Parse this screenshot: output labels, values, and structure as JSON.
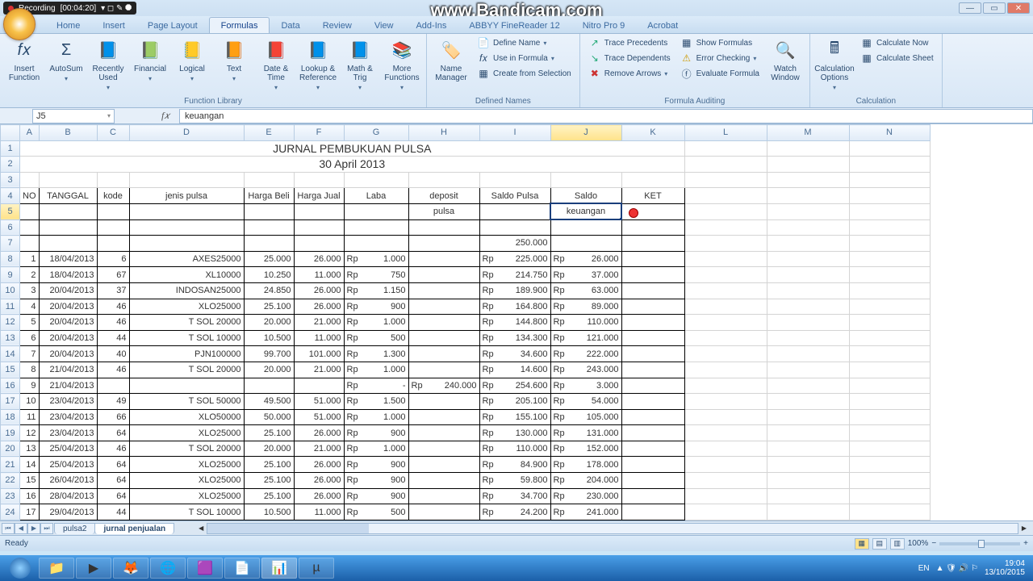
{
  "recorder": {
    "label": "Recording",
    "time": "00:04:20"
  },
  "watermark": "www.Bandicam.com",
  "window": {
    "app": "Microsoft Excel"
  },
  "tabs": [
    "Home",
    "Insert",
    "Page Layout",
    "Formulas",
    "Data",
    "Review",
    "View",
    "Add-Ins",
    "ABBYY FineReader 12",
    "Nitro Pro 9",
    "Acrobat"
  ],
  "active_tab": "Formulas",
  "ribbon": {
    "function_library": {
      "label": "Function Library",
      "items": [
        "Insert Function",
        "AutoSum",
        "Recently Used",
        "Financial",
        "Logical",
        "Text",
        "Date & Time",
        "Lookup & Reference",
        "Math & Trig",
        "More Functions"
      ]
    },
    "defined_names": {
      "label": "Defined Names",
      "big": "Name Manager",
      "items": [
        "Define Name",
        "Use in Formula",
        "Create from Selection"
      ]
    },
    "formula_auditing": {
      "label": "Formula Auditing",
      "left": [
        "Trace Precedents",
        "Trace Dependents",
        "Remove Arrows"
      ],
      "right": [
        "Show Formulas",
        "Error Checking",
        "Evaluate Formula"
      ],
      "watch": "Watch Window"
    },
    "calculation": {
      "label": "Calculation",
      "big": "Calculation Options",
      "items": [
        "Calculate Now",
        "Calculate Sheet"
      ]
    }
  },
  "namebox": "J5",
  "formula": "keuangan",
  "columns": [
    "A",
    "B",
    "C",
    "D",
    "E",
    "F",
    "G",
    "H",
    "I",
    "J",
    "K",
    "L",
    "M",
    "N"
  ],
  "title": "JURNAL PEMBUKUAN PULSA",
  "subtitle": "30 April 2013",
  "headers": [
    "NO",
    "TANGGAL",
    "kode",
    "jenis pulsa",
    "Harga Beli",
    "Harga Jual",
    "Laba",
    "deposit",
    "Saldo Pulsa",
    "Saldo",
    "KET"
  ],
  "subheaders": {
    "H": "pulsa",
    "J": "keuangan"
  },
  "initial_saldo": "250.000",
  "rows": [
    {
      "no": 1,
      "tgl": "18/04/2013",
      "kode": 6,
      "jenis": "AXES25000",
      "beli": "25.000",
      "jual": "26.000",
      "laba": "1.000",
      "dep": "",
      "saldoP": "225.000",
      "saldoK": "26.000"
    },
    {
      "no": 2,
      "tgl": "18/04/2013",
      "kode": 67,
      "jenis": "XL10000",
      "beli": "10.250",
      "jual": "11.000",
      "laba": "750",
      "dep": "",
      "saldoP": "214.750",
      "saldoK": "37.000"
    },
    {
      "no": 3,
      "tgl": "20/04/2013",
      "kode": 37,
      "jenis": "INDOSAN25000",
      "beli": "24.850",
      "jual": "26.000",
      "laba": "1.150",
      "dep": "",
      "saldoP": "189.900",
      "saldoK": "63.000"
    },
    {
      "no": 4,
      "tgl": "20/04/2013",
      "kode": 46,
      "jenis": "XLO25000",
      "beli": "25.100",
      "jual": "26.000",
      "laba": "900",
      "dep": "",
      "saldoP": "164.800",
      "saldoK": "89.000"
    },
    {
      "no": 5,
      "tgl": "20/04/2013",
      "kode": 46,
      "jenis": "T SOL 20000",
      "beli": "20.000",
      "jual": "21.000",
      "laba": "1.000",
      "dep": "",
      "saldoP": "144.800",
      "saldoK": "110.000"
    },
    {
      "no": 6,
      "tgl": "20/04/2013",
      "kode": 44,
      "jenis": "T SOL 10000",
      "beli": "10.500",
      "jual": "11.000",
      "laba": "500",
      "dep": "",
      "saldoP": "134.300",
      "saldoK": "121.000"
    },
    {
      "no": 7,
      "tgl": "20/04/2013",
      "kode": 40,
      "jenis": "PJN100000",
      "beli": "99.700",
      "jual": "101.000",
      "laba": "1.300",
      "dep": "",
      "saldoP": "34.600",
      "saldoK": "222.000"
    },
    {
      "no": 8,
      "tgl": "21/04/2013",
      "kode": 46,
      "jenis": "T SOL 20000",
      "beli": "20.000",
      "jual": "21.000",
      "laba": "1.000",
      "dep": "",
      "saldoP": "14.600",
      "saldoK": "243.000"
    },
    {
      "no": 9,
      "tgl": "21/04/2013",
      "kode": "",
      "jenis": "",
      "beli": "",
      "jual": "",
      "laba": "-",
      "dep": "240.000",
      "saldoP": "254.600",
      "saldoK": "3.000"
    },
    {
      "no": 10,
      "tgl": "23/04/2013",
      "kode": 49,
      "jenis": "T SOL 50000",
      "beli": "49.500",
      "jual": "51.000",
      "laba": "1.500",
      "dep": "",
      "saldoP": "205.100",
      "saldoK": "54.000"
    },
    {
      "no": 11,
      "tgl": "23/04/2013",
      "kode": 66,
      "jenis": "XLO50000",
      "beli": "50.000",
      "jual": "51.000",
      "laba": "1.000",
      "dep": "",
      "saldoP": "155.100",
      "saldoK": "105.000"
    },
    {
      "no": 12,
      "tgl": "23/04/2013",
      "kode": 64,
      "jenis": "XLO25000",
      "beli": "25.100",
      "jual": "26.000",
      "laba": "900",
      "dep": "",
      "saldoP": "130.000",
      "saldoK": "131.000"
    },
    {
      "no": 13,
      "tgl": "25/04/2013",
      "kode": 46,
      "jenis": "T SOL 20000",
      "beli": "20.000",
      "jual": "21.000",
      "laba": "1.000",
      "dep": "",
      "saldoP": "110.000",
      "saldoK": "152.000"
    },
    {
      "no": 14,
      "tgl": "25/04/2013",
      "kode": 64,
      "jenis": "XLO25000",
      "beli": "25.100",
      "jual": "26.000",
      "laba": "900",
      "dep": "",
      "saldoP": "84.900",
      "saldoK": "178.000"
    },
    {
      "no": 15,
      "tgl": "26/04/2013",
      "kode": 64,
      "jenis": "XLO25000",
      "beli": "25.100",
      "jual": "26.000",
      "laba": "900",
      "dep": "",
      "saldoP": "59.800",
      "saldoK": "204.000"
    },
    {
      "no": 16,
      "tgl": "28/04/2013",
      "kode": 64,
      "jenis": "XLO25000",
      "beli": "25.100",
      "jual": "26.000",
      "laba": "900",
      "dep": "",
      "saldoP": "34.700",
      "saldoK": "230.000"
    },
    {
      "no": 17,
      "tgl": "29/04/2013",
      "kode": 44,
      "jenis": "T SOL 10000",
      "beli": "10.500",
      "jual": "11.000",
      "laba": "500",
      "dep": "",
      "saldoP": "24.200",
      "saldoK": "241.000"
    }
  ],
  "sheet_tabs": [
    "pulsa2",
    "jurnal penjualan"
  ],
  "active_sheet_tab": "jurnal penjualan",
  "status": "Ready",
  "zoom": "100%",
  "taskbar_time": "19:04",
  "taskbar_date": "13/10/2015",
  "lang": "EN"
}
